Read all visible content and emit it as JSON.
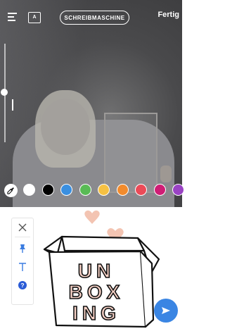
{
  "header": {
    "font_style_label": "SCHREIBMASCHINE",
    "done_label": "Fertig",
    "font_icon_text": "A"
  },
  "palette": {
    "colors": [
      "#ffffff",
      "#000000",
      "#3a8fe0",
      "#59bb55",
      "#f6c143",
      "#f28b2d",
      "#eb4b58",
      "#cf1d75",
      "#9a43c4"
    ]
  },
  "sticker": {
    "lines": [
      "UN",
      "BOX",
      "ING"
    ]
  },
  "tools": [
    "close-icon",
    "pin-icon",
    "text-icon",
    "help-icon"
  ]
}
